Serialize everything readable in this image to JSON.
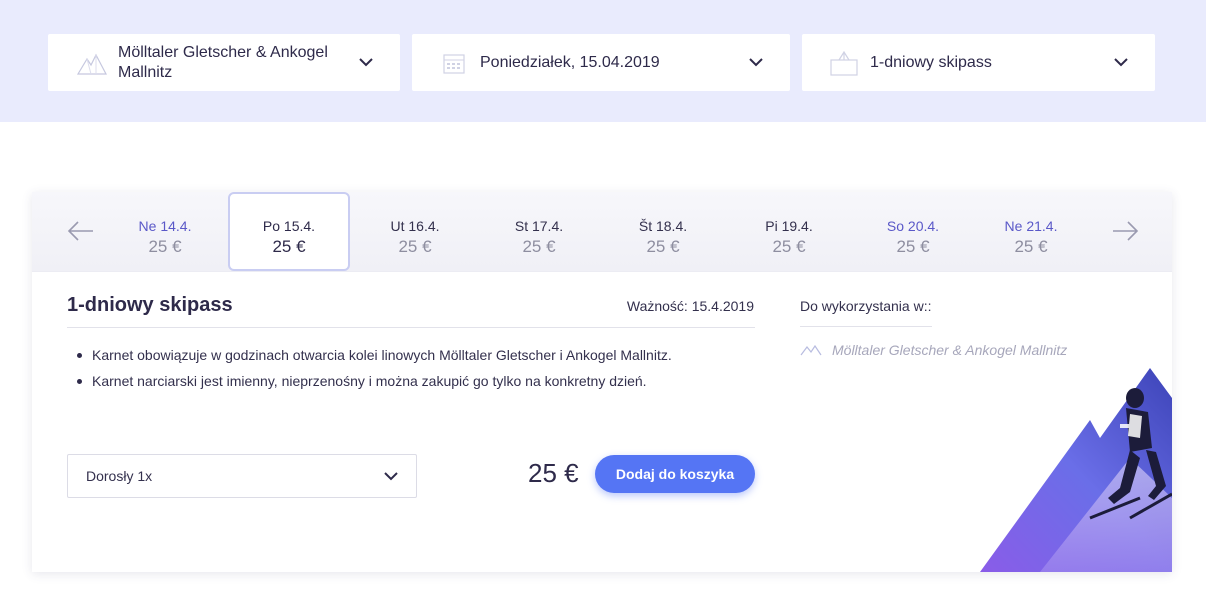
{
  "filters": {
    "resort": {
      "value": "Mölltaler Gletscher & Ankogel Mallnitz",
      "icon": "mountain-icon"
    },
    "date": {
      "value": "Poniedziałek, 15.04.2019",
      "icon": "calendar-icon"
    },
    "pass": {
      "value": "1-dniowy skipass",
      "icon": "ticket-icon"
    }
  },
  "days": [
    {
      "label": "Ne 14.4.",
      "price": "25 €",
      "weekend": true
    },
    {
      "label": "Po 15.4.",
      "price": "25 €",
      "active": true
    },
    {
      "label": "Ut 16.4.",
      "price": "25 €"
    },
    {
      "label": "St 17.4.",
      "price": "25 €"
    },
    {
      "label": "Št 18.4.",
      "price": "25 €"
    },
    {
      "label": "Pi 19.4.",
      "price": "25 €"
    },
    {
      "label": "So 20.4.",
      "price": "25 €",
      "weekend": true
    },
    {
      "label": "Ne 21.4.",
      "price": "25 €",
      "weekend": true
    }
  ],
  "pass": {
    "title": "1-dniowy skipass",
    "validity": "Ważność: 15.4.2019",
    "rules": [
      "Karnet obowiązuje w godzinach otwarcia kolei linowych Mölltaler Gletscher i Ankogel Mallnitz.",
      "Karnet narciarski jest imienny, nieprzenośny i można zakupić go tylko na konkretny dzień."
    ]
  },
  "usage": {
    "label": "Do wykorzystania w::",
    "place": "Mölltaler Gletscher & Ankogel Mallnitz"
  },
  "purchase": {
    "quantity": "Dorosły 1x",
    "price": "25 €",
    "add_label": "Dodaj do koszyka"
  },
  "colors": {
    "topbar": "#e9ebfd",
    "accent": "#5575f4",
    "weekend": "#5a58c8"
  }
}
